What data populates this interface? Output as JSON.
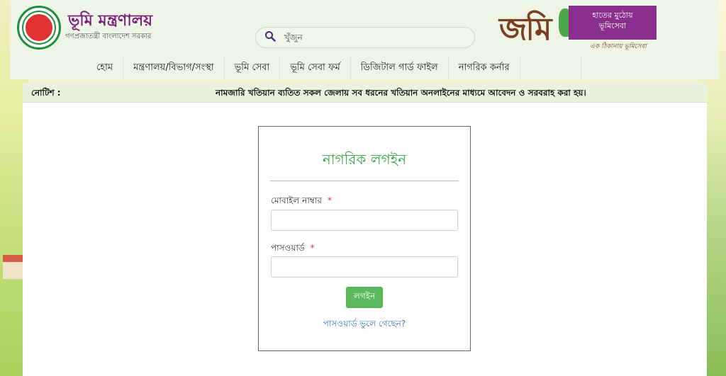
{
  "header": {
    "brand_title": "ভূমি মন্ত্রণালয়",
    "brand_subtitle": "গণপ্রজাতন্ত্রী বাংলাদেশ সরকার",
    "search_placeholder": "খুঁজুন",
    "jomi_logo": {
      "word": "জমি",
      "tagline_line1": "হাতের মুঠোয়",
      "tagline_line2": "ভূমিসেবা",
      "subtitle": "এক ঠিকানায় ভূমিসেবা"
    }
  },
  "nav": {
    "items": [
      {
        "label": "হোম"
      },
      {
        "label": "মন্ত্রণালয়/বিভাগ/সংস্থা"
      },
      {
        "label": "ভূমি সেবা"
      },
      {
        "label": "ভূমি সেবা ফর্ম"
      },
      {
        "label": "ডিজিটাল গার্ড ফাইল"
      },
      {
        "label": "নাগরিক কর্নার"
      }
    ]
  },
  "notice": {
    "label": "নোটিশ :",
    "text": "নামজারি খতিয়ান ব্যতিত সকল জেলায় সব ধরনের খতিয়ান অনলাইনের মাধ্যমে আবেদন ও সরবরাহ করা হয়।"
  },
  "login": {
    "title": "নাগরিক লগইন",
    "mobile_label": "মোবাইল নাম্বার",
    "password_label": "পাসওয়ার্ড",
    "required_mark": "*",
    "submit_label": "লগইন",
    "forgot_label": "পাসওয়ার্ড ভুলে গেছেন?"
  },
  "colors": {
    "brand_purple": "#7a1c7c",
    "login_green": "#38a83d",
    "button_green": "#5cb85c",
    "link_blue": "#3a7bb5",
    "header_bg": "#eef5e6"
  }
}
